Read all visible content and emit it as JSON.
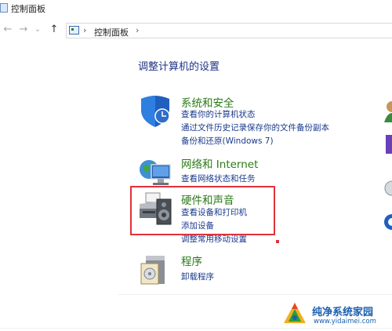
{
  "window": {
    "title": "控制面板"
  },
  "nav": {
    "back": "←",
    "forward": "→",
    "dropdown": "⌄",
    "up": "↑"
  },
  "address": {
    "sep": "›",
    "crumb": "控制面板"
  },
  "page": {
    "title": "调整计算机的设置"
  },
  "categories": [
    {
      "title": "系统和安全",
      "icon": "shield-icon",
      "links": [
        "查看你的计算机状态",
        "通过文件历史记录保存你的文件备份副本",
        "备份和还原(Windows 7)"
      ]
    },
    {
      "title": "网络和 Internet",
      "icon": "network-globe-icon",
      "links": [
        "查看网络状态和任务"
      ]
    },
    {
      "title": "硬件和声音",
      "icon": "printer-speaker-icon",
      "links": [
        "查看设备和打印机",
        "添加设备",
        "调整常用移动设置"
      ]
    },
    {
      "title": "程序",
      "icon": "programs-box-icon",
      "links": [
        "卸载程序"
      ]
    }
  ],
  "watermark": {
    "title": "纯净系统家园",
    "url": "www.yidaimei.com"
  },
  "colors": {
    "link": "#1a3a8c",
    "category": "#2a7a16",
    "heading": "#1e3287",
    "highlight": "#e0313a",
    "watermark": "#1a5fb0"
  }
}
